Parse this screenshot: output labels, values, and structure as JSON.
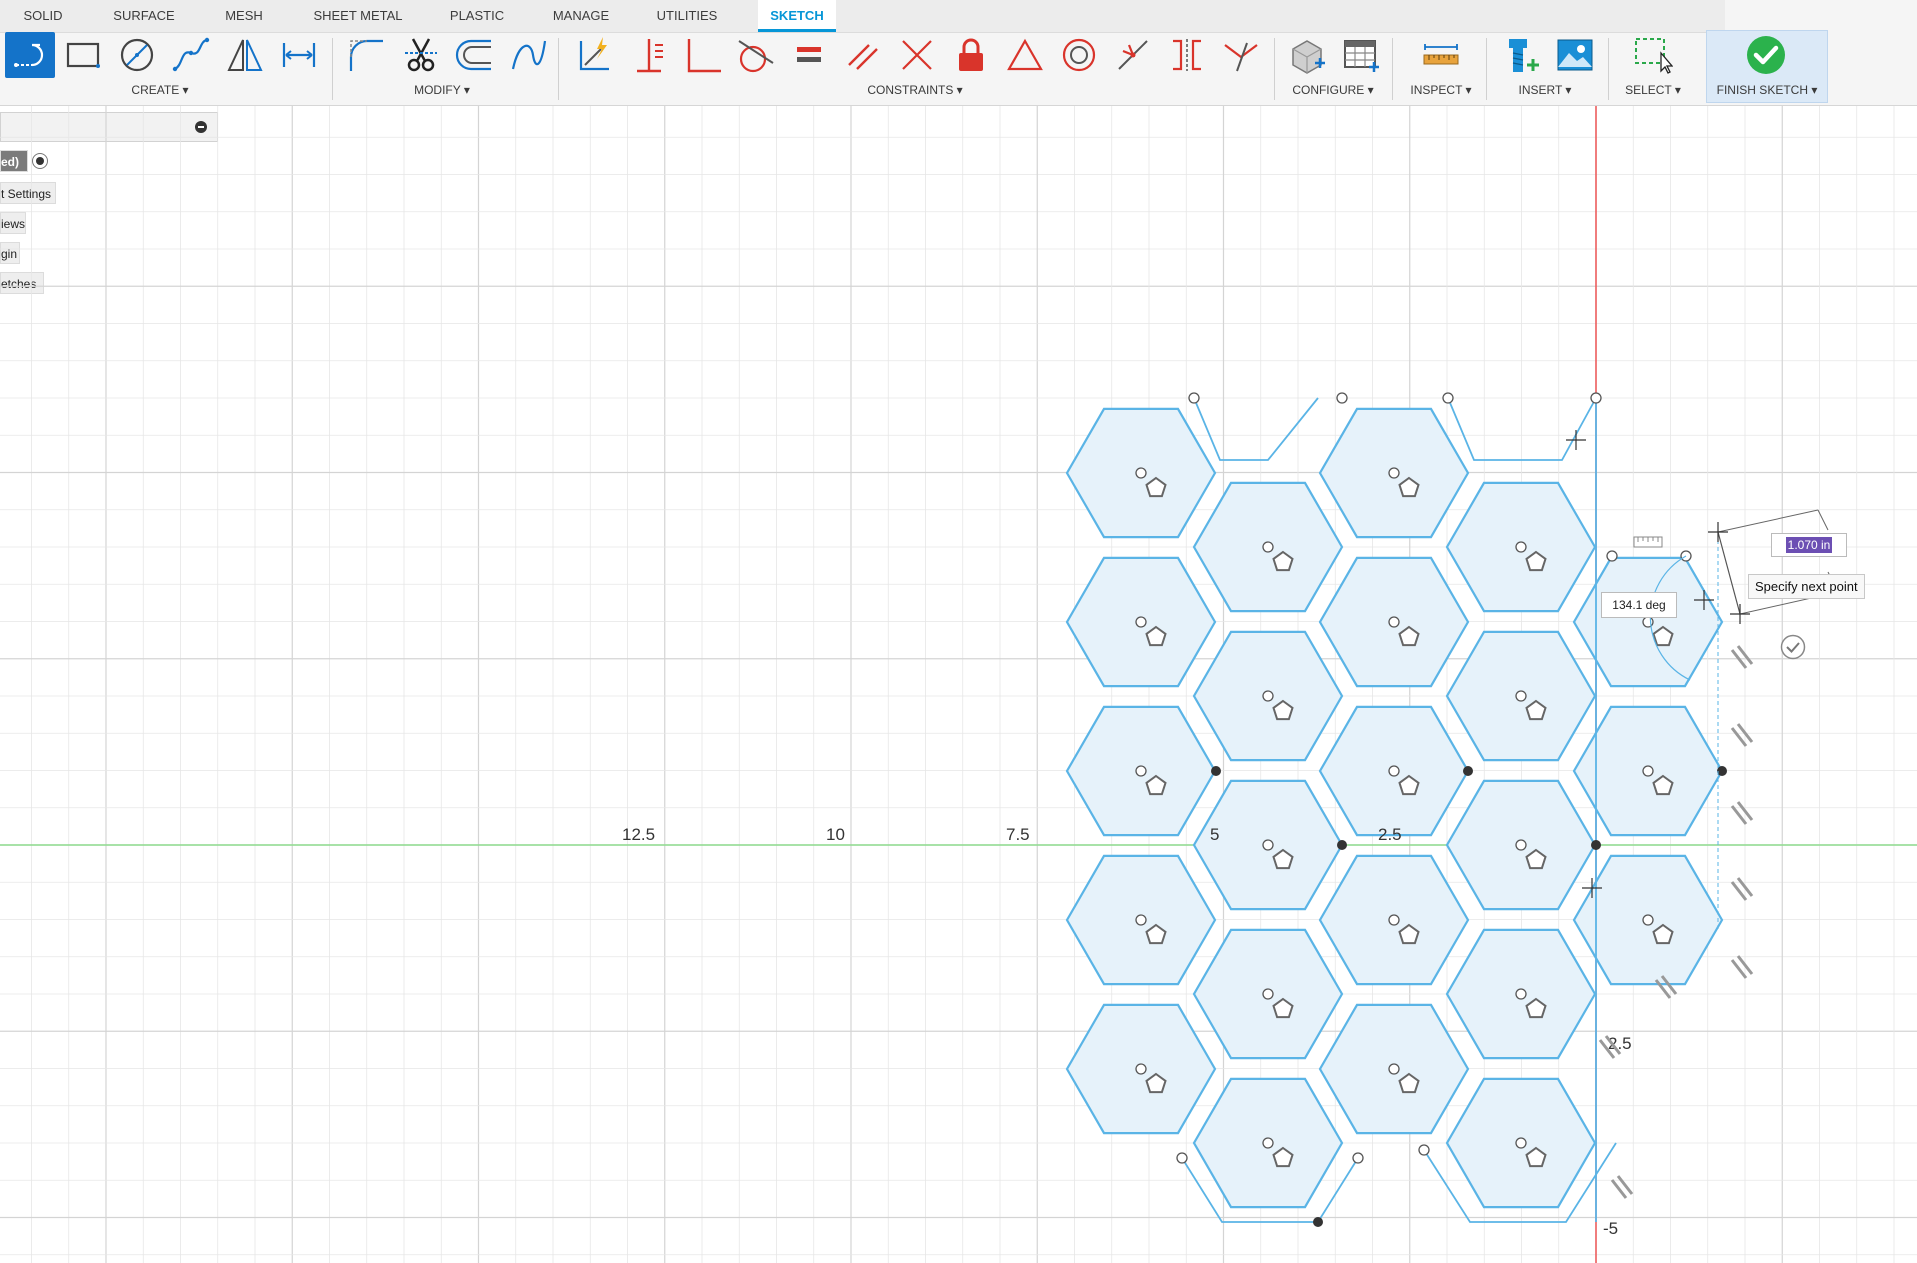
{
  "tabs": [
    {
      "label": "SOLID",
      "active": false
    },
    {
      "label": "SURFACE",
      "active": false
    },
    {
      "label": "MESH",
      "active": false
    },
    {
      "label": "SHEET METAL",
      "active": false
    },
    {
      "label": "PLASTIC",
      "active": false
    },
    {
      "label": "MANAGE",
      "active": false
    },
    {
      "label": "UTILITIES",
      "active": false
    },
    {
      "label": "SKETCH",
      "active": true
    }
  ],
  "groups": {
    "create": "CREATE ▾",
    "modify": "MODIFY ▾",
    "constraints": "CONSTRAINTS ▾",
    "configure": "CONFIGURE ▾",
    "inspect": "INSPECT ▾",
    "insert": "INSERT ▾",
    "select": "SELECT ▾",
    "finish": "FINISH SKETCH ▾"
  },
  "tools": {
    "create": [
      "line-icon",
      "rectangle-icon",
      "circle-icon",
      "spline-icon",
      "mirror-icon",
      "dimension-icon"
    ],
    "modify": [
      "fillet-icon",
      "trim-icon",
      "offset-icon",
      "conic-icon"
    ],
    "constraints": [
      "autoconstrain-icon",
      "perpendicular-icon",
      "fix-icon",
      "tangent-icon",
      "equal-icon",
      "parallel-icon",
      "collinear-icon",
      "lock-icon",
      "triangle-icon",
      "concentric-icon",
      "midpoint-icon",
      "symmetry-icon",
      "curvature-icon"
    ]
  },
  "browser": {
    "items": [
      "ed)",
      "t Settings",
      "iews",
      "gin",
      "etches"
    ]
  },
  "axis": {
    "x_labels": [
      "12.5",
      "10",
      "7.5",
      "5",
      "2.5"
    ],
    "y_labels": [
      "2.5",
      "-5"
    ]
  },
  "dimension": {
    "length": "1.070 in",
    "angle": "134.1 deg"
  },
  "tooltip": "Specify next point",
  "colors": {
    "accent": "#0696d7",
    "sketch_line": "#5ab4e6",
    "profile_fill": "#e6f2fa",
    "x_axis": "#8fdc8f",
    "y_axis": "#ee5555",
    "grid": "#e6e6e6",
    "grid_major": "#d4d4d4",
    "dim_highlight": "#6c4fb3"
  }
}
